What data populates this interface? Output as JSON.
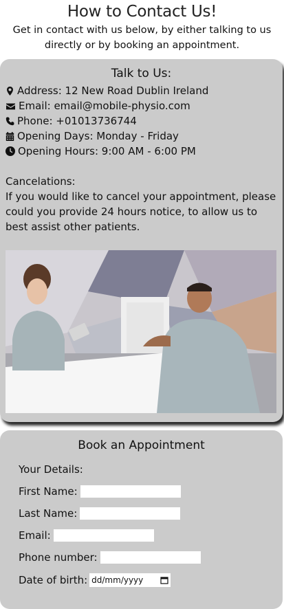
{
  "header": {
    "title": "How to Contact Us!",
    "intro": "Get in contact with us below, by either talking to us directly or by booking an appointment."
  },
  "talk": {
    "title": "Talk to Us:",
    "address": "Address: 12 New Road Dublin Ireland",
    "email": "Email: email@mobile-physio.com",
    "phone": "Phone: +01013736744",
    "days": "Opening Days: Monday - Friday",
    "hours": "Opening Hours: 9:00 AM - 6:00 PM",
    "cancel_heading": "Cancelations:",
    "cancel_text": "If you would like to cancel your appointment, please could you provide 24 hours notice, to allow us to best assist other patients."
  },
  "booking": {
    "title": "Book an Appointment",
    "details_label": "Your Details:",
    "first_name_label": "First Name:",
    "last_name_label": "Last Name:",
    "email_label": "Email:",
    "phone_label": "Phone number:",
    "dob_label": "Date of birth:",
    "dob_placeholder": "dd/mm/yyyy"
  },
  "icons": {
    "address": "map-marker-icon",
    "email": "envelope-icon",
    "phone": "phone-icon",
    "days": "calendar-icon",
    "hours": "clock-icon"
  },
  "colors": {
    "card_background": "#cbcbcb",
    "page_background": "#ffffff"
  }
}
